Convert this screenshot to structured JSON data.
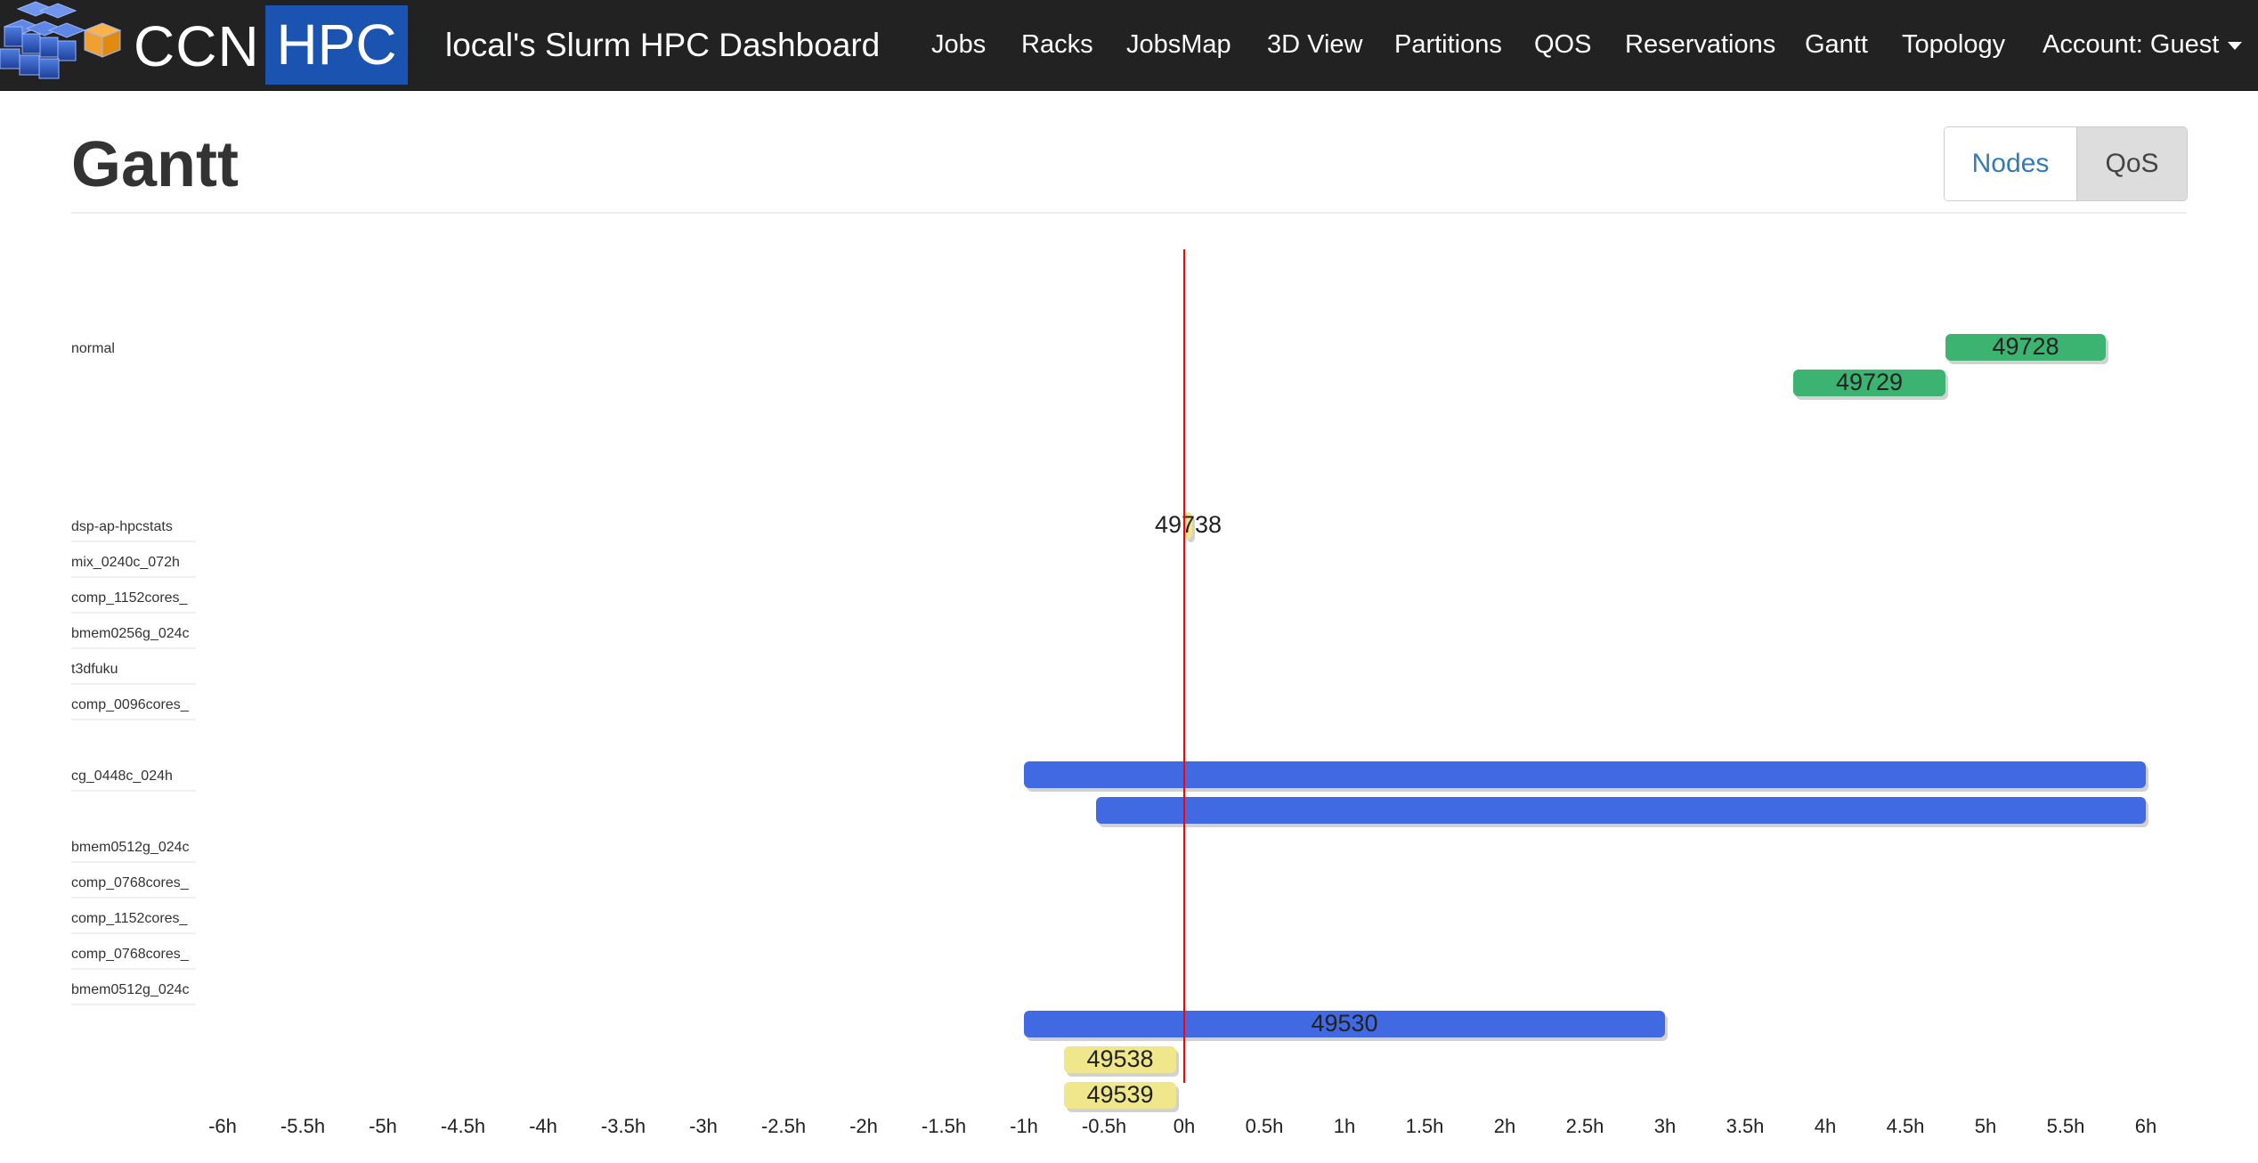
{
  "navbar": {
    "brand_left": "CCN",
    "brand_right": "HPC",
    "title": "local's Slurm HPC Dashboard",
    "items": [
      "Jobs",
      "Racks",
      "JobsMap",
      "3D View",
      "Partitions",
      "QOS",
      "Reservations",
      "Gantt",
      "Topology"
    ],
    "account": "Account: Guest"
  },
  "page": {
    "title": "Gantt",
    "toggle": {
      "nodes": "Nodes",
      "qos": "QoS",
      "active": "Nodes"
    }
  },
  "colors": {
    "navbar_bg": "#222222",
    "brand_blue": "#1a54b0",
    "running": "#4169e1",
    "planned": "#3cb371",
    "pending": "#f0e68c",
    "now_line": "#ff0000",
    "active_toggle_text": "#337ab7"
  },
  "chart_data": {
    "type": "gantt",
    "x_unit": "h",
    "xlim": [
      -6,
      6
    ],
    "x_ticks": [
      "-6h",
      "-5.5h",
      "-5h",
      "-4.5h",
      "-4h",
      "-3.5h",
      "-3h",
      "-2.5h",
      "-2h",
      "-1.5h",
      "-1h",
      "-0.5h",
      "0h",
      "0.5h",
      "1h",
      "1.5h",
      "2h",
      "2.5h",
      "3h",
      "3.5h",
      "4h",
      "4.5h",
      "5h",
      "5.5h",
      "6h"
    ],
    "now": 0,
    "rows": [
      "normal",
      "dsp-ap-hpcstats",
      "mix_0240c_072h",
      "comp_1152cores_",
      "bmem0256g_024c",
      "t3dfuku",
      "comp_0096cores_",
      "cg_0448c_024h",
      "bmem0512g_024c",
      "comp_0768cores_",
      "comp_1152cores_",
      "comp_0768cores_",
      "bmem0512g_024c"
    ],
    "jobs": [
      {
        "id": "49728",
        "row": "normal",
        "lane": 0,
        "start": 4.75,
        "end": 5.75,
        "color": "#3cb371",
        "label": "49728"
      },
      {
        "id": "49729",
        "row": "normal",
        "lane": 1,
        "start": 3.8,
        "end": 4.75,
        "color": "#3cb371",
        "label": "49729"
      },
      {
        "id": "49738",
        "row": "dsp-ap-hpcstats",
        "lane": 0,
        "start": 0,
        "end": 0.05,
        "color": "#f0e68c",
        "label": "49738"
      },
      {
        "id": "cg-job-1",
        "row": "cg_0448c_024h",
        "lane": 0,
        "start": -1,
        "end": 6,
        "color": "#4169e1",
        "label": ""
      },
      {
        "id": "cg-job-2",
        "row": "cg_0448c_024h",
        "lane": 1,
        "start": -0.55,
        "end": 6,
        "color": "#4169e1",
        "label": ""
      },
      {
        "id": "49530",
        "row": "bmem0512g_024c",
        "lane": 1,
        "start": -1,
        "end": 3,
        "color": "#4169e1",
        "label": "49530"
      },
      {
        "id": "49538",
        "row": "bmem0512g_024c",
        "lane": 2,
        "start": -0.75,
        "end": -0.05,
        "color": "#f0e68c",
        "label": "49538"
      },
      {
        "id": "49539",
        "row": "bmem0512g_024c",
        "lane": 3,
        "start": -0.75,
        "end": -0.05,
        "color": "#f0e68c",
        "label": "49539"
      }
    ]
  }
}
